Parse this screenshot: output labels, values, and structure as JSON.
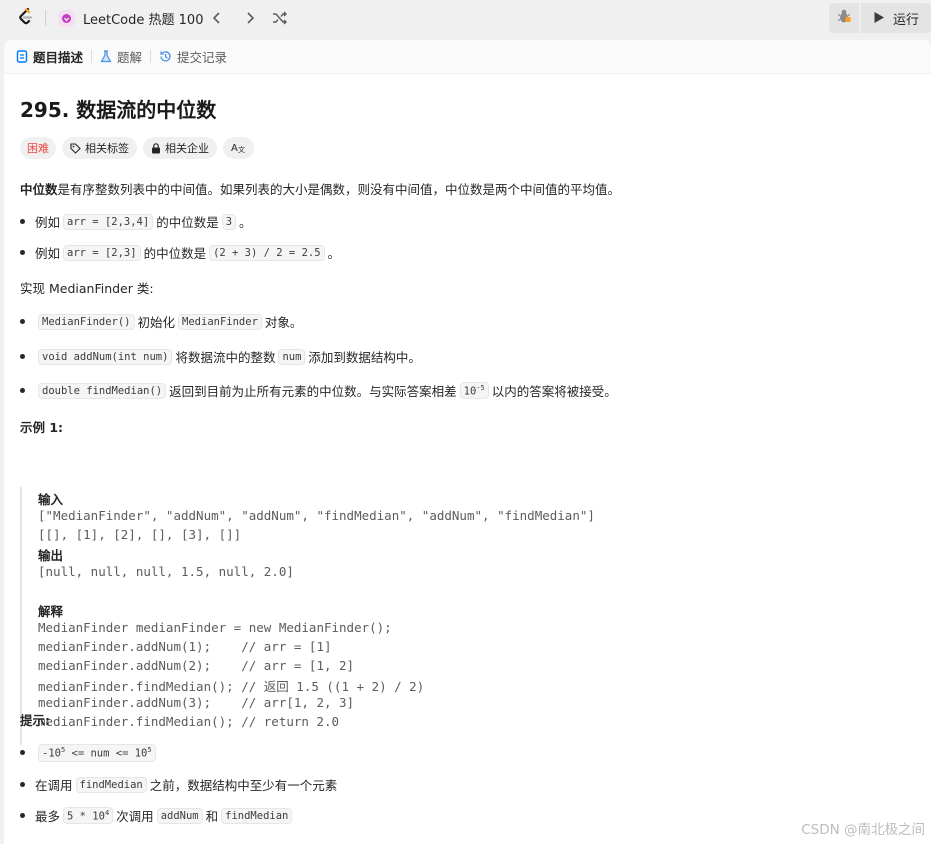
{
  "nav": {
    "problem_list_title": "LeetCode 热题 100",
    "run_label": "运行"
  },
  "tabs": [
    {
      "label": "题目描述",
      "active": true
    },
    {
      "label": "题解",
      "active": false
    },
    {
      "label": "提交记录",
      "active": false
    }
  ],
  "problem": {
    "title": "295. 数据流的中位数",
    "tags": {
      "difficulty": "困难",
      "related_tags": "相关标签",
      "related_companies": "相关企业",
      "font_icon": "A文"
    },
    "intro_bold": "中位数",
    "intro_rest": "是有序整数列表中的中间值。如果列表的大小是偶数，则没有中间值，中位数是两个中间值的平均值。",
    "examples_list": [
      {
        "prefix": "例如",
        "code": "arr = [2,3,4]",
        "mid": "的中位数是",
        "code2": "3",
        "suffix": "。"
      },
      {
        "prefix": "例如",
        "code": "arr = [2,3]",
        "mid": "的中位数是",
        "code2": "(2 + 3) / 2 = 2.5",
        "suffix": "。"
      }
    ],
    "implement": "实现 MedianFinder 类:",
    "methods": [
      {
        "code": "MedianFinder()",
        "text1": "初始化",
        "code2": "MedianFinder",
        "text2": "对象。"
      },
      {
        "code": "void addNum(int num)",
        "text1": "将数据流中的整数",
        "code2": "num",
        "text2": "添加到数据结构中。"
      },
      {
        "code": "double findMedian()",
        "text1": "返回到目前为止所有元素的中位数。与实际答案相差",
        "code2_base": "10",
        "code2_exp": "-5",
        "text2": "以内的答案将被接受。"
      }
    ],
    "example_title": "示例 1:",
    "example": {
      "input_label": "输入",
      "input_line1": "[\"MedianFinder\", \"addNum\", \"addNum\", \"findMedian\", \"addNum\", \"findMedian\"]",
      "input_line2": "[[], [1], [2], [], [3], []]",
      "output_label": "输出",
      "output_line": "[null, null, null, 1.5, null, 2.0]",
      "explain_label": "解释",
      "explain_lines": [
        "MedianFinder medianFinder = new MedianFinder();",
        "medianFinder.addNum(1);    // arr = [1]",
        "medianFinder.addNum(2);    // arr = [1, 2]",
        "medianFinder.findMedian(); // 返回 1.5 ((1 + 2) / 2)",
        "medianFinder.addNum(3);    // arr[1, 2, 3]",
        "medianFinder.findMedian(); // return 2.0"
      ]
    },
    "hint_title": "提示:",
    "hints": {
      "h1_a": "-10",
      "h1_a_exp": "5",
      "h1_b": " <= num <= 10",
      "h1_b_exp": "5",
      "h2_prefix": "在调用",
      "h2_code": "findMedian",
      "h2_suffix": "之前，数据结构中至少有一个元素",
      "h3_prefix": "最多",
      "h3_code_base": "5 * 10",
      "h3_code_exp": "4",
      "h3_mid": "次调用",
      "h3_code2": "addNum",
      "h3_and": "和",
      "h3_code3": "findMedian"
    }
  },
  "watermark": "CSDN @南北极之间",
  "colors": {
    "hard": "#ef4743",
    "plist_icon": "#c040c0"
  }
}
